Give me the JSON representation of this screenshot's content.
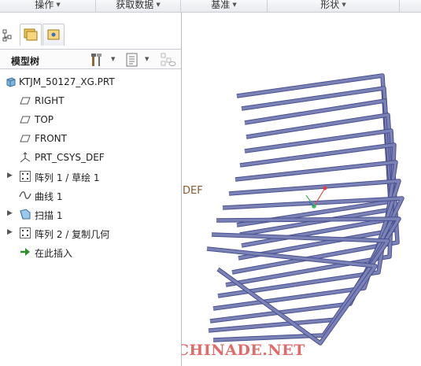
{
  "ribbon": {
    "groups": [
      {
        "label": "操作"
      },
      {
        "label": "获取数据"
      },
      {
        "label": "基准"
      },
      {
        "label": "形状"
      }
    ]
  },
  "navigator": {
    "title": "模型树",
    "items": [
      {
        "label": "KTJM_50127_XG.PRT",
        "icon": "part-icon",
        "expandable": false
      },
      {
        "label": "RIGHT",
        "icon": "datum-plane-icon",
        "expandable": false
      },
      {
        "label": "TOP",
        "icon": "datum-plane-icon",
        "expandable": false
      },
      {
        "label": "FRONT",
        "icon": "datum-plane-icon",
        "expandable": false
      },
      {
        "label": "PRT_CSYS_DEF",
        "icon": "csys-icon",
        "expandable": false
      },
      {
        "label": "阵列 1 / 草绘 1",
        "icon": "pattern-icon",
        "expandable": true
      },
      {
        "label": "曲线 1",
        "icon": "curve-icon",
        "expandable": false
      },
      {
        "label": "扫描 1",
        "icon": "sweep-icon",
        "expandable": true
      },
      {
        "label": "阵列 2 / 复制几何",
        "icon": "pattern-icon",
        "expandable": true
      },
      {
        "label": "在此插入",
        "icon": "insert-here-arrow-icon",
        "expandable": false
      }
    ]
  },
  "graphics": {
    "csys_label": "DEF",
    "watermark": "BBS.CHINADE.NET",
    "frame_color": "#7b82b6",
    "frame_edge_color": "#4a5090"
  }
}
